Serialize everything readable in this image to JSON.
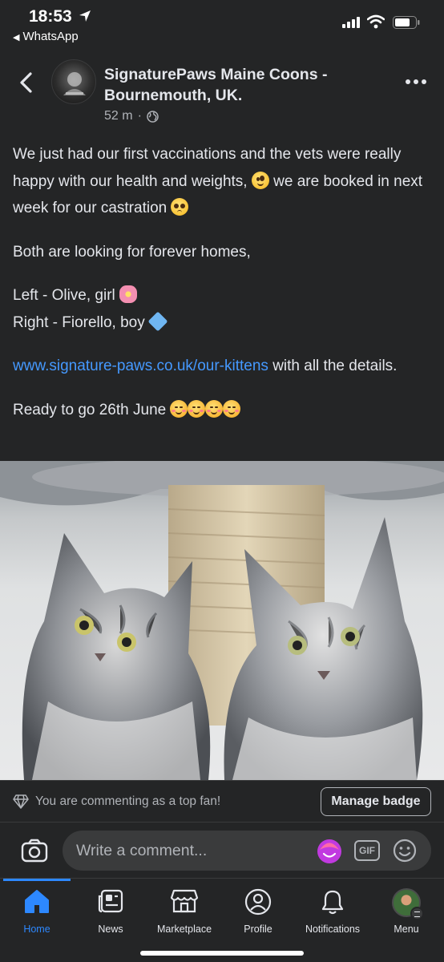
{
  "status_bar": {
    "time": "18:53",
    "back_app": "WhatsApp"
  },
  "post": {
    "author": "SignaturePaws Maine Coons - Bournemouth, UK.",
    "timestamp": "52 m",
    "separator": "·",
    "paragraph1_a": "We just had our first vaccinations and the vets were really happy with our health and weights,",
    "paragraph1_b": "we are booked in next week for our castration",
    "paragraph2": "Both are looking for forever homes,",
    "line_left": "Left - Olive, girl",
    "line_right": "Right - Fiorello, boy",
    "link": "www.signature-paws.co.uk/our-kittens",
    "link_suffix": "with all the details.",
    "ready": "Ready to go 26th June",
    "emojis": [
      "zany-face",
      "pleading-face",
      "cherry-blossom",
      "diamond-shape",
      "smiling-face-with-hearts"
    ]
  },
  "fan_bar": {
    "text": "You are commenting as a top fan!",
    "button": "Manage badge"
  },
  "comment_bar": {
    "placeholder": "Write a comment...",
    "gif_label": "GIF"
  },
  "tabs": [
    {
      "label": "Home",
      "icon": "home-icon",
      "active": true
    },
    {
      "label": "News",
      "icon": "news-icon",
      "active": false
    },
    {
      "label": "Marketplace",
      "icon": "marketplace-icon",
      "active": false
    },
    {
      "label": "Profile",
      "icon": "profile-icon",
      "active": false
    },
    {
      "label": "Notifications",
      "icon": "bell-icon",
      "active": false
    },
    {
      "label": "Menu",
      "icon": "menu-avatar",
      "active": false
    }
  ],
  "colors": {
    "background": "#242526",
    "link": "#4599ff",
    "active_tab": "#2d88ff",
    "text": "#e4e6eb",
    "secondary_text": "#b0b3b8"
  }
}
